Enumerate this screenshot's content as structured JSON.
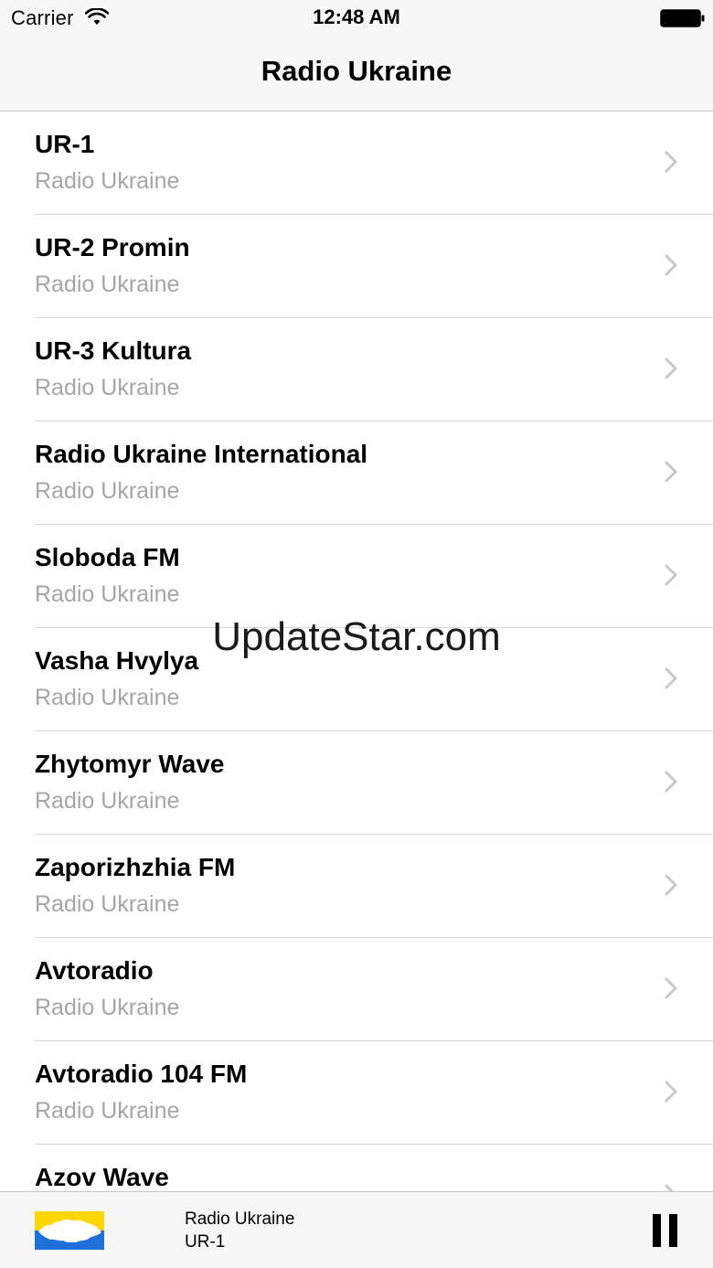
{
  "status_bar": {
    "carrier": "Carrier",
    "time": "12:48 AM"
  },
  "nav": {
    "title": "Radio Ukraine"
  },
  "stations": [
    {
      "name": "UR-1",
      "subtitle": "Radio Ukraine"
    },
    {
      "name": "UR-2 Promin",
      "subtitle": "Radio Ukraine"
    },
    {
      "name": "UR-3 Kultura",
      "subtitle": "Radio Ukraine"
    },
    {
      "name": "Radio Ukraine International",
      "subtitle": "Radio Ukraine"
    },
    {
      "name": "Sloboda FM",
      "subtitle": "Radio Ukraine"
    },
    {
      "name": "Vasha Hvylya",
      "subtitle": "Radio Ukraine"
    },
    {
      "name": "Zhytomyr Wave",
      "subtitle": "Radio Ukraine"
    },
    {
      "name": "Zaporizhzhia FM",
      "subtitle": "Radio Ukraine"
    },
    {
      "name": "Avtoradio",
      "subtitle": "Radio Ukraine"
    },
    {
      "name": "Avtoradio 104 FM",
      "subtitle": "Radio Ukraine"
    },
    {
      "name": "Azov Wave",
      "subtitle": ""
    }
  ],
  "watermark": "UpdateStar.com",
  "player": {
    "station": "Radio Ukraine",
    "track": "UR-1"
  },
  "colors": {
    "flag_blue": "#1f6fd8",
    "flag_yellow": "#ffd700",
    "subtitle_gray": "#a6a6a6",
    "bar_background": "#f7f7f7"
  },
  "icons": {
    "status": [
      "wifi-icon",
      "battery-icon"
    ],
    "row_accessory": "chevron-right-icon",
    "player_control": "pause-icon"
  }
}
